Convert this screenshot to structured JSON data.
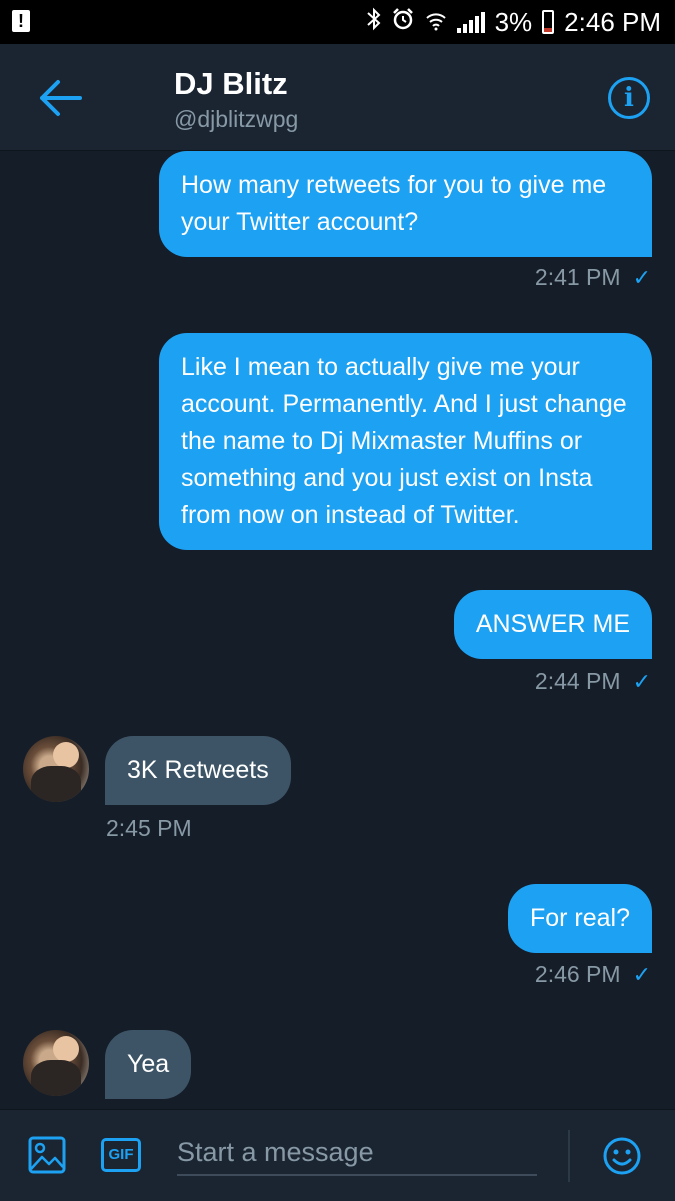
{
  "status_bar": {
    "alert_icon": "alert-icon",
    "bluetooth_icon": "bluetooth-icon",
    "alarm_icon": "alarm-icon",
    "wifi_icon": "wifi-icon",
    "signal_icon": "signal-icon",
    "battery_percent": "3%",
    "battery_level": 0.03,
    "time": "2:46 PM"
  },
  "header": {
    "back_icon": "arrow-left-icon",
    "title": "DJ Blitz",
    "handle": "@djblitzwpg",
    "info_icon": "info-icon",
    "info_glyph": "i"
  },
  "messages": [
    {
      "direction": "outgoing",
      "text": "How many retweets for you to give me your Twitter account?",
      "time": "2:41 PM",
      "read": true
    },
    {
      "direction": "outgoing",
      "text": "Like I mean to actually give me your account. Permanently. And I just change the name to Dj Mixmaster Muffins or something and you just exist on Insta from now on instead of Twitter."
    },
    {
      "direction": "outgoing",
      "text": "ANSWER ME",
      "time": "2:44 PM",
      "read": true
    },
    {
      "direction": "incoming",
      "text": "3K Retweets",
      "time": "2:45 PM"
    },
    {
      "direction": "outgoing",
      "text": "For real?",
      "time": "2:46 PM",
      "read": true
    },
    {
      "direction": "incoming",
      "text": "Yea"
    }
  ],
  "check_glyph": "✓",
  "composer": {
    "image_icon": "image-icon",
    "gif_label": "GIF",
    "placeholder": "Start a message",
    "value": "",
    "emoji_icon": "emoji-icon"
  },
  "colors": {
    "accent": "#1da1f2",
    "background": "#151d28",
    "header": "#1b2532",
    "incoming_bubble": "#3d5466",
    "muted_text": "#8899a6"
  }
}
